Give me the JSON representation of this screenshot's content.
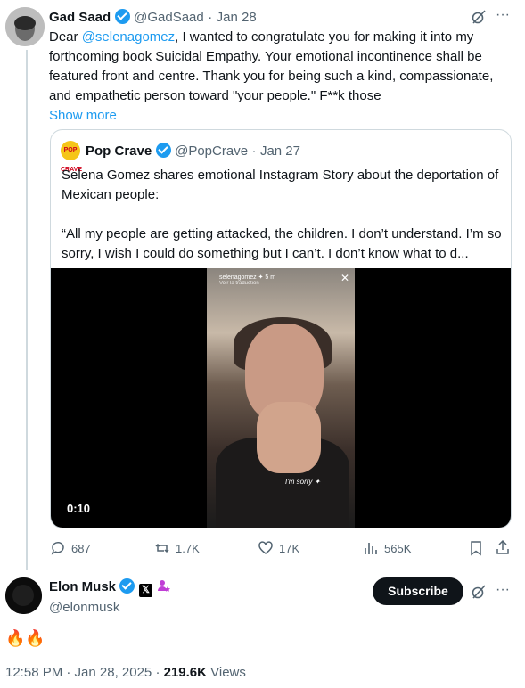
{
  "tweet": {
    "author_name": "Gad Saad",
    "handle": "@GadSaad",
    "date": "Jan 28",
    "text_prefix": "Dear ",
    "mention": "@selenagomez",
    "text_rest": ", I wanted to congratulate you for making it into my forthcoming book Suicidal Empathy.  Your emotional incontinence shall be featured front and centre.  Thank you for being such a kind, compassionate, and empathetic person toward \"your people.\"  F**k those",
    "show_more": "Show more",
    "quote": {
      "author_name": "Pop Crave",
      "logo_text": "POP CRAVE",
      "handle": "@PopCrave",
      "date": "Jan 27",
      "paragraph1": "Selena Gomez shares emotional Instagram Story about the deportation of Mexican people:",
      "paragraph2": "“All my people are getting attacked, the children. I don’t understand. I’m so sorry, I wish I could do something but I can’t. I don’t know what to d...",
      "video": {
        "timestamp": "0:10",
        "story_user": "selenagomez ✦ 5 m",
        "story_sub": "Voir la traduction",
        "caption": "I'm sorry ✦"
      }
    },
    "actions": {
      "replies": "687",
      "reposts": "1.7K",
      "likes": "17K",
      "views": "565K"
    }
  },
  "reply": {
    "author_name": "Elon Musk",
    "handle": "@elonmusk",
    "subscribe_label": "Subscribe",
    "xbadge": "𝕏",
    "text": "🔥🔥",
    "footer_time": "12:58 PM · Jan 28, 2025 · ",
    "footer_views_count": "219.6K",
    "footer_views_label": " Views"
  },
  "icons": [
    "grok-icon",
    "more-icon",
    "reply-icon",
    "repost-icon",
    "like-icon",
    "views-icon",
    "bookmark-icon",
    "share-icon"
  ]
}
